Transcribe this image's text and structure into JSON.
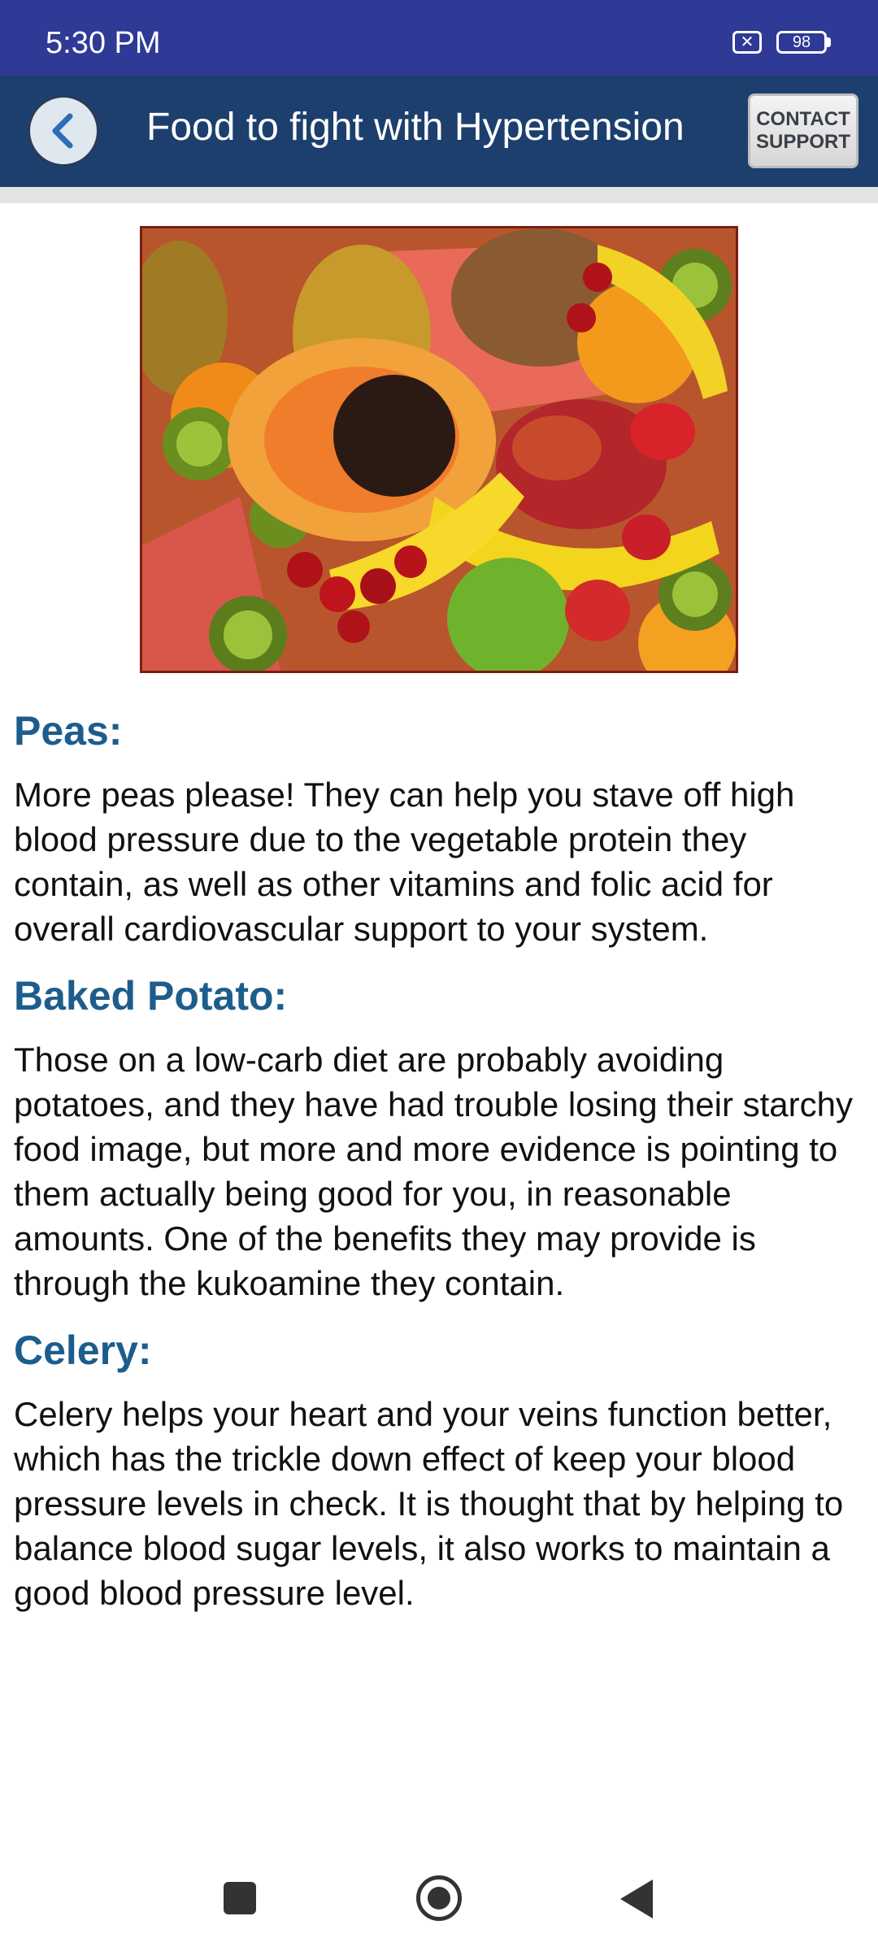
{
  "status_bar": {
    "time": "5:30 PM",
    "battery": "98"
  },
  "app_bar": {
    "title": "Food to fight with Hypertension",
    "contact_line1": "CONTACT",
    "contact_line2": "SUPPORT"
  },
  "sections": [
    {
      "heading": "Peas:",
      "text": "More peas please! They can help you stave off high blood pressure due to the vegetable protein they contain, as well as other vitamins and folic acid for overall cardiovascular support to your system."
    },
    {
      "heading": "Baked Potato:",
      "text": "Those on a low-carb diet are probably avoiding potatoes, and they have had trouble losing their starchy food image, but more and more evidence is pointing to them actually being good for you, in reasonable amounts. One of the benefits they may provide is through the kukoamine they contain."
    },
    {
      "heading": "Celery:",
      "text": "Celery helps your heart and your veins function better, which has the trickle down effect of keep your blood pressure levels in check. It is thought that by helping to balance blood sugar levels, it also works to maintain a good blood pressure level."
    }
  ]
}
